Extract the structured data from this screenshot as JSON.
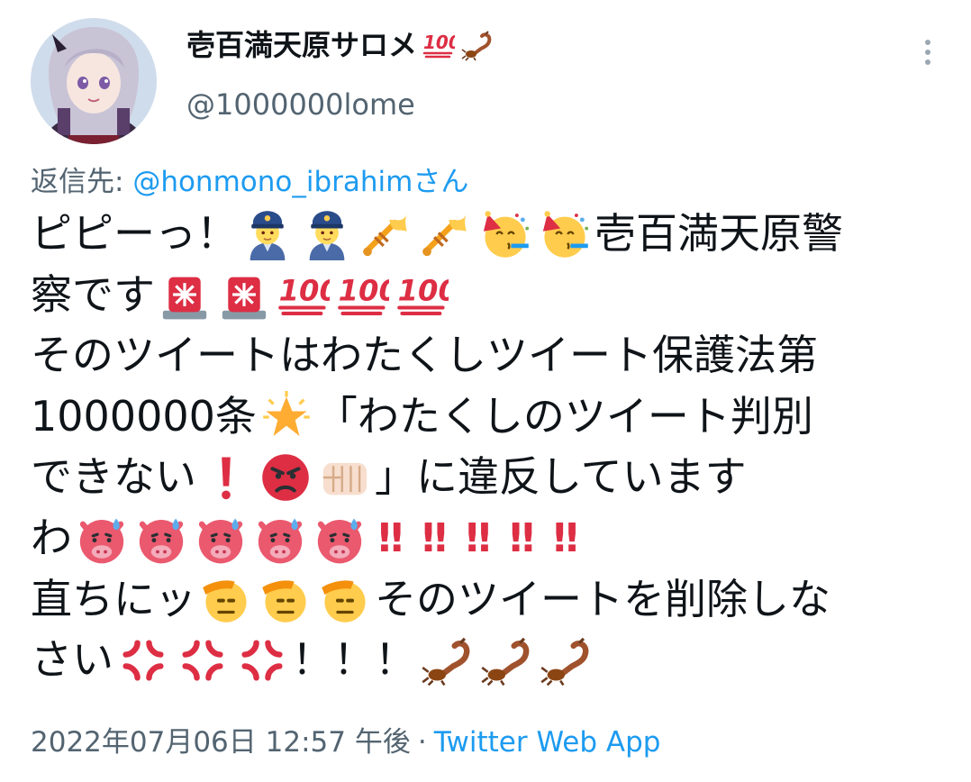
{
  "user": {
    "display_name": "壱百満天原サロメ",
    "name_emojis": [
      "hundred-points-emoji",
      "scorpion-emoji"
    ],
    "handle": "@1000000lome"
  },
  "reply": {
    "prefix": "返信先: ",
    "target": "@honmono_ibrahim",
    "suffix": "さん"
  },
  "tweet": {
    "line1_a": "ピピーっ！",
    "line1_b": "壱百満天原警",
    "line2_a": "察です",
    "line3": "そのツイートはわたくしツイート保護法第",
    "line4_a": "1000000条",
    "line4_b": "「わたくしのツイート判別",
    "line5_a": "できない",
    "line5_b": "」に違反していますわ",
    "line5_b_main": "」に違反しています",
    "line6_a": "わ",
    "line6_excl": "‼",
    "line7_a": "直ちにッ",
    "line7_b": "そのツイートを削除しな",
    "line8_a": "さい",
    "line8_b": "！！！"
  },
  "footer": {
    "date": "2022年07月06日 12:57 午後",
    "separator": "·",
    "source": "Twitter Web App"
  },
  "colors": {
    "link": "#1d9bf0",
    "secondary_text": "#536471",
    "primary_text": "#0f1419",
    "emphasis_red": "#dd2e44"
  }
}
